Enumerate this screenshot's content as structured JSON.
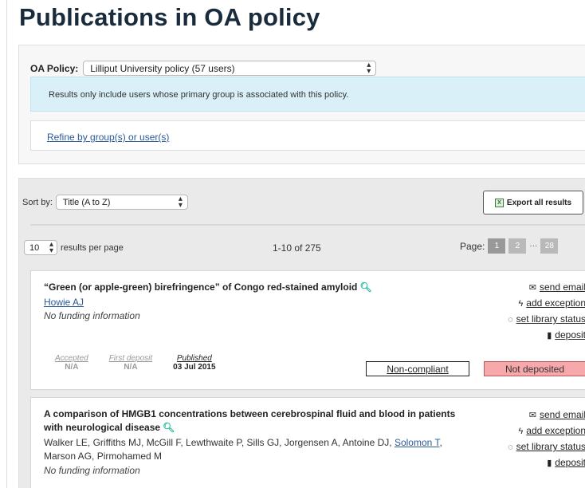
{
  "page": {
    "title": "Publications in OA policy"
  },
  "policy": {
    "label": "OA Policy:",
    "selected": "Lilliput University policy (57 users)",
    "info": "Results only include users whose primary group is associated with this policy.",
    "refine_link": "Refine by group(s) or user(s)"
  },
  "results": {
    "sort_label": "Sort by:",
    "sort_selected": "Title (A to Z)",
    "export_label": "Export all results",
    "per_page_value": "10",
    "per_page_label": "results per page",
    "range": "1-10 of 275",
    "page_label": "Page:",
    "pages": [
      "1",
      "2",
      "28"
    ],
    "ellipsis": "···"
  },
  "actions": {
    "send_email": "send email",
    "add_exception": "add exception",
    "set_library_status": "set library status",
    "deposit": "deposit"
  },
  "items": [
    {
      "title": "“Green (or apple-green) birefringence” of Congo red-stained amyloid",
      "author_link": "Howie AJ",
      "funding": "No funding information",
      "dates": {
        "accepted_label": "Accepted",
        "accepted_value": "N/A",
        "first_deposit_label": "First deposit",
        "first_deposit_value": "N/A",
        "published_label": "Published",
        "published_value": "03 Jul 2015"
      },
      "compliance": "Non-compliant",
      "deposit_status": "Not deposited"
    },
    {
      "title": "A comparison of HMGB1 concentrations between cerebrospinal fluid and blood in patients with neurological disease",
      "authors_prefix": "Walker LE, Griffiths MJ, McGill F, Lewthwaite P, Sills GJ, Jorgensen A, Antoine DJ, ",
      "author_link": "Solomon T",
      "authors_suffix": ", Marson AG, Pirmohamed M",
      "funding": "No funding information"
    }
  ],
  "colors": {
    "info_bg": "#d9f0f9",
    "not_deposited_bg": "#f7a8ab",
    "search_icon": "#1fb89a",
    "link": "#2a5a9b"
  },
  "icons": {
    "send_email": "envelope-icon",
    "add_exception": "bolt-icon",
    "set_library_status": "speech-bubble-icon",
    "deposit": "file-upload-icon",
    "search": "magnifier-icon",
    "export": "spreadsheet-icon"
  }
}
